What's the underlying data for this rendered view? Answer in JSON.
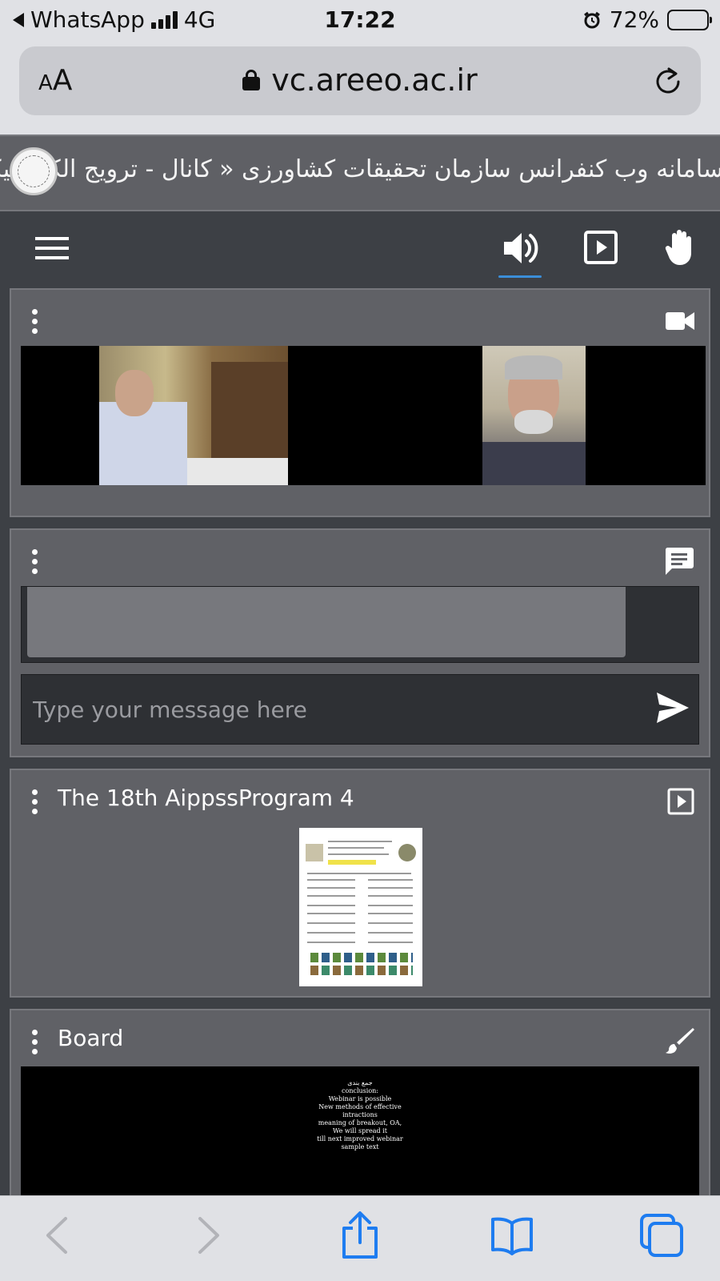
{
  "status_bar": {
    "back_app": "WhatsApp",
    "network": "4G",
    "time": "17:22",
    "battery": "72%"
  },
  "browser": {
    "text_size_label_small": "A",
    "text_size_label_large": "A",
    "url": "vc.areeo.ac.ir"
  },
  "site": {
    "title": "سامانه وب کنفرانس سازمان تحقیقات کشاورزی « کانال - ترویج الکترونیکی ایران"
  },
  "panels": {
    "video": {},
    "chat": {
      "input_placeholder": "Type your message here"
    },
    "presentation": {
      "title": "The 18th AippssProgram 4"
    },
    "board": {
      "title": "Board",
      "lines": [
        "جمع بندی",
        "conclusion:",
        "",
        "Webinar is possible",
        "New methods of effective",
        "intractions",
        "",
        "meaning of breakout, OA,",
        "",
        "We will spread it",
        "till next improved webinar",
        "",
        "",
        "",
        "sample text"
      ]
    }
  },
  "colors": {
    "accent": "#3b8ed8",
    "ios_blue": "#1e7cf0",
    "panel_bg": "#606166",
    "page_bg": "#3d4045"
  },
  "icons": {
    "toolbar": [
      "menu-icon",
      "speaker-icon",
      "play-icon",
      "raise-hand-icon"
    ],
    "bottom": [
      "back-icon",
      "forward-icon",
      "share-icon",
      "bookmarks-icon",
      "tabs-icon"
    ]
  }
}
